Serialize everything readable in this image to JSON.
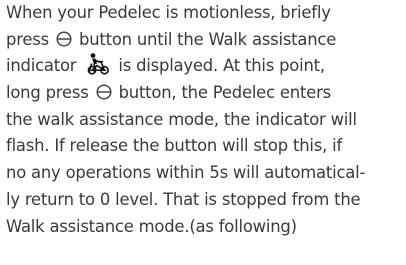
{
  "paragraph": {
    "line1": "When your Pedelec is motionless, briefly",
    "line2a": "press",
    "line2b": "button until the Walk assistance",
    "line3a": "indicator",
    "line3b": "is displayed. At this point,",
    "line4a": "long press",
    "line4b": "button, the Pedelec enters",
    "line5": "the walk assistance mode, the indicator will",
    "line6": "flash. If release the button will stop this, if",
    "line7": "no any operations within 5s will automatical-",
    "line8": "ly return to 0 level. That is stopped from the",
    "line9": "Walk assistance mode.(as following)"
  },
  "icons": {
    "minus_button": "minus-button-icon",
    "walk_assist": "walk-assistance-icon"
  }
}
